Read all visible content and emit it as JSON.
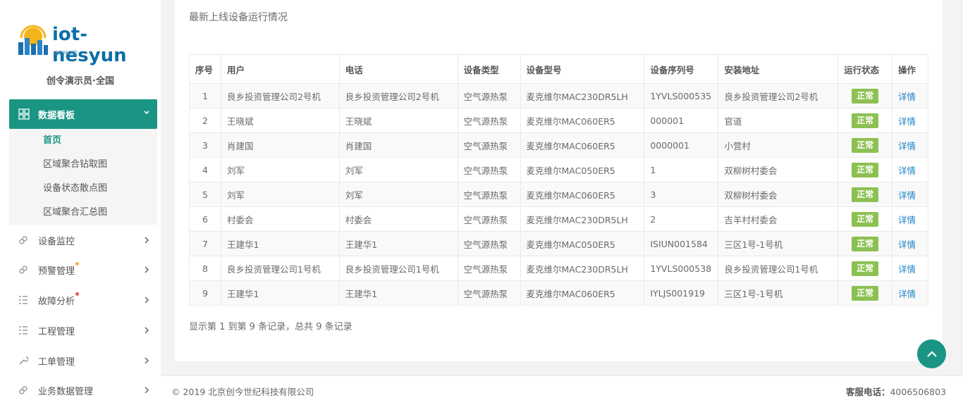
{
  "sidebar": {
    "logo_text": "iot-nesyun",
    "logo_sub": "DEMO版",
    "user": "创令演示员·全国",
    "active_menu": {
      "label": "数据看板",
      "icon": "grid-icon"
    },
    "sub_items": [
      {
        "label": "首页",
        "active": true
      },
      {
        "label": "区域聚合钻取图",
        "active": false
      },
      {
        "label": "设备状态散点图",
        "active": false
      },
      {
        "label": "区域聚合汇总图",
        "active": false
      }
    ],
    "menu": [
      {
        "label": "设备监控",
        "icon": "link-icon"
      },
      {
        "label": "预警管理",
        "icon": "link-icon",
        "dot": "#f0ad4e"
      },
      {
        "label": "故障分析",
        "icon": "list-icon",
        "dot": "#ed5565"
      },
      {
        "label": "工程管理",
        "icon": "list-icon"
      },
      {
        "label": "工单管理",
        "icon": "wrench-icon"
      },
      {
        "label": "业务数据管理",
        "icon": "link-icon"
      }
    ]
  },
  "main": {
    "title": "最新上线设备运行情况",
    "columns": [
      "序号",
      "用户",
      "电话",
      "设备类型",
      "设备型号",
      "设备序列号",
      "安装地址",
      "运行状态",
      "操作"
    ],
    "rows": [
      [
        "1",
        "良乡投资管理公司2号机",
        "良乡投资管理公司2号机",
        "空气源热泵",
        "麦克维尔MAC230DR5LH",
        "1YVLS000535",
        "良乡投资管理公司2号机",
        "正常",
        "详情"
      ],
      [
        "2",
        "王晓斌",
        "王晓斌",
        "空气源热泵",
        "麦克维尔MAC060ER5",
        "000001",
        "官道",
        "正常",
        "详情"
      ],
      [
        "3",
        "肖建国",
        "肖建国",
        "空气源热泵",
        "麦克维尔MAC060ER5",
        "0000001",
        "小营村",
        "正常",
        "详情"
      ],
      [
        "4",
        "刘军",
        "刘军",
        "空气源热泵",
        "麦克维尔MAC050ER5",
        "1",
        "双柳树村委会",
        "正常",
        "详情"
      ],
      [
        "5",
        "刘军",
        "刘军",
        "空气源热泵",
        "麦克维尔MAC060ER5",
        "3",
        "双柳树村委会",
        "正常",
        "详情"
      ],
      [
        "6",
        "村委会",
        "村委会",
        "空气源热泵",
        "麦克维尔MAC230DR5LH",
        "2",
        "吉羊村村委会",
        "正常",
        "详情"
      ],
      [
        "7",
        "王建华1",
        "王建华1",
        "空气源热泵",
        "麦克维尔MAC050ER5",
        "ISIUN001584",
        "三区1号-1号机",
        "正常",
        "详情"
      ],
      [
        "8",
        "良乡投资管理公司1号机",
        "良乡投资管理公司1号机",
        "空气源热泵",
        "麦克维尔MAC230DR5LH",
        "1YVLS000538",
        "良乡投资管理公司1号机",
        "正常",
        "详情"
      ],
      [
        "9",
        "王建华1",
        "王建华1",
        "空气源热泵",
        "麦克维尔MAC060ER5",
        "IYLJS001919",
        "三区1号-1号机",
        "正常",
        "详情"
      ]
    ],
    "pager": "显示第 1 到第 9 条记录，总共 9 条记录"
  },
  "footer": {
    "copyright": "© 2019 北京创今世纪科技有限公司",
    "service_label": "客服电话：",
    "service_phone": "4006506803"
  },
  "colors": {
    "accent": "#1a9583",
    "ok": "#8cc152",
    "link": "#1c84c6"
  }
}
